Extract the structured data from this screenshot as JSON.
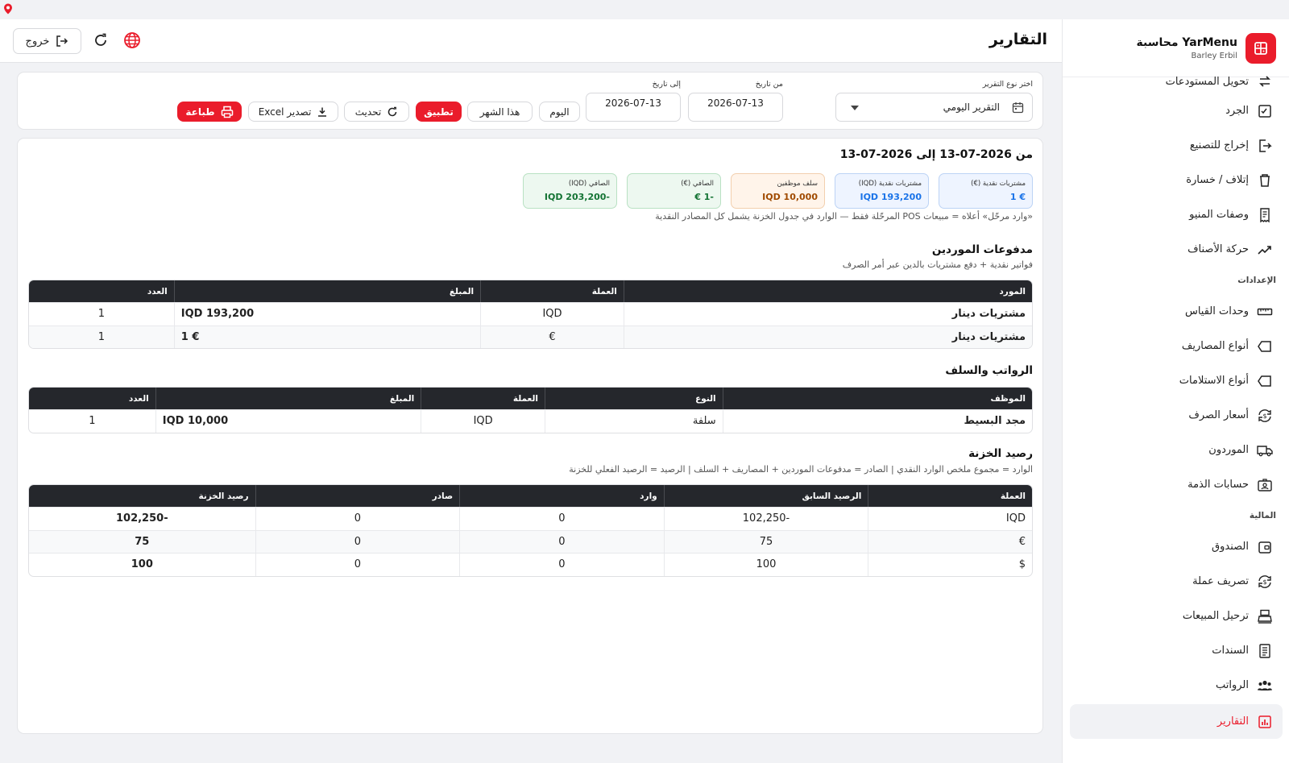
{
  "sidebar": {
    "app_title": "YarMenu محاسبة",
    "app_subtitle": "Barley Erbil",
    "items_top": [
      {
        "label": "تحويل المستودعات",
        "icon": "transfer-icon"
      },
      {
        "label": "الجرد",
        "icon": "checklist-icon"
      },
      {
        "label": "إخراج للتصنيع",
        "icon": "exit-icon"
      },
      {
        "label": "إتلاف / خسارة",
        "icon": "trash-icon"
      },
      {
        "label": "وصفات المنيو",
        "icon": "receipt-icon"
      },
      {
        "label": "حركة الأصناف",
        "icon": "trend-icon"
      }
    ],
    "section_settings": "الإعدادات",
    "items_settings": [
      {
        "label": "وحدات القياس",
        "icon": "ruler-icon"
      },
      {
        "label": "أنواع المصاريف",
        "icon": "tag-icon"
      },
      {
        "label": "أنواع الاستلامات",
        "icon": "tag-icon"
      },
      {
        "label": "أسعار الصرف",
        "icon": "exchange-icon"
      },
      {
        "label": "الموردون",
        "icon": "truck-icon"
      },
      {
        "label": "حسابات الذمة",
        "icon": "id-card-icon"
      }
    ],
    "section_finance": "المالية",
    "items_finance": [
      {
        "label": "الصندوق",
        "icon": "wallet-icon"
      },
      {
        "label": "تصريف عملة",
        "icon": "exchange-icon"
      },
      {
        "label": "ترحيل المبيعات",
        "icon": "register-icon"
      },
      {
        "label": "السندات",
        "icon": "document-icon"
      },
      {
        "label": "الرواتب",
        "icon": "people-icon"
      },
      {
        "label": "التقارير",
        "icon": "report-icon",
        "active": true
      }
    ]
  },
  "header": {
    "title": "التقارير",
    "logout_label": "خروج"
  },
  "filters": {
    "report_type_label": "اختر نوع التقرير",
    "report_type_value": "التقرير اليومي",
    "from_label": "من تاريخ",
    "from_value": "2026-07-13",
    "to_label": "إلى تاريخ",
    "to_value": "2026-07-13",
    "today_label": "اليوم",
    "this_month_label": "هذا الشهر",
    "apply_label": "تطبيق",
    "refresh_label": "تحديث",
    "export_label": "تصدير Excel",
    "print_label": "طباعة"
  },
  "report": {
    "range_title": "من 2026-07-13 إلى 2026-07-13",
    "stats": [
      {
        "label": "مشتريات نقدية (€)",
        "value": "€ 1",
        "bg": "#eef4ff",
        "border": "#bcd3f5",
        "color": "#1a73e8"
      },
      {
        "label": "مشتريات نقدية (IQD)",
        "value": "IQD 193,200",
        "bg": "#eef4ff",
        "border": "#bcd3f5",
        "color": "#1a73e8"
      },
      {
        "label": "سلف موظفين",
        "value": "IQD 10,000",
        "bg": "#fff4ea",
        "border": "#f2cfae",
        "color": "#a04a00"
      },
      {
        "label": "الصافي (€)",
        "value": "-1 €",
        "bg": "#edf8f0",
        "border": "#b9e1c3",
        "color": "#137333"
      },
      {
        "label": "الصافي (IQD)",
        "value": "-IQD 203,200",
        "bg": "#edf8f0",
        "border": "#b9e1c3",
        "color": "#137333"
      }
    ],
    "pos_note": "«وارد مرحّل» أعلاه = مبيعات POS المرحّلة فقط — الوارد في جدول الخزنة يشمل كل المصادر النقدية",
    "suppliers": {
      "title": "مدفوعات الموردين",
      "subtitle": "فواتير نقدية + دفع مشتريات بالدين عبر أمر الصرف",
      "columns": [
        "المورد",
        "العملة",
        "المبلغ",
        "العدد"
      ],
      "rows": [
        [
          "مشتريات دينار",
          "IQD",
          "IQD 193,200",
          "1"
        ],
        [
          "مشتريات دينار",
          "€",
          "€ 1",
          "1"
        ]
      ]
    },
    "salaries": {
      "title": "الرواتب والسلف",
      "columns": [
        "الموظف",
        "النوع",
        "العملة",
        "المبلغ",
        "العدد"
      ],
      "rows": [
        [
          "مجد البسيط",
          "سلفة",
          "IQD",
          "IQD 10,000",
          "1"
        ]
      ]
    },
    "treasury": {
      "title": "رصيد الخزنة",
      "subtitle": "الوارد = مجموع ملخص الوارد النقدي | الصادر = مدفوعات الموردين + المصاريف + السلف | الرصيد = الرصيد الفعلي للخزنة",
      "columns": [
        "العملة",
        "الرصيد السابق",
        "وارد",
        "صادر",
        "رصيد الخزنة"
      ],
      "rows": [
        [
          "IQD",
          "-102,250",
          "0",
          "0",
          "-102,250"
        ],
        [
          "€",
          "75",
          "0",
          "0",
          "75"
        ],
        [
          "$",
          "100",
          "0",
          "0",
          "100"
        ]
      ]
    }
  },
  "colors": {
    "accent": "#ea1c2b",
    "header_dark": "#25272c",
    "link_blue": "#1a73e8"
  }
}
